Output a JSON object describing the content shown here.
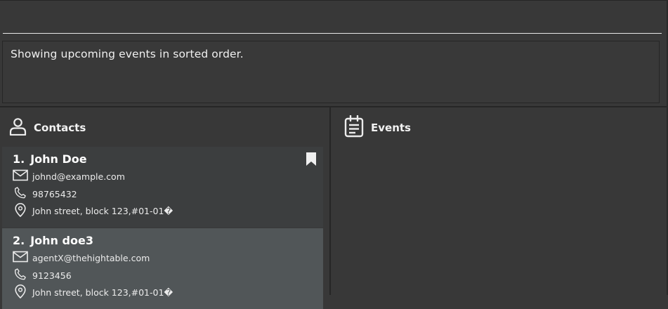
{
  "command": {
    "value": "",
    "placeholder": ""
  },
  "result": {
    "message": "Showing upcoming events in sorted order."
  },
  "contacts_panel": {
    "title": "Contacts",
    "icon": "person-icon"
  },
  "events_panel": {
    "title": "Events",
    "icon": "calendar-icon"
  },
  "contacts": [
    {
      "index": "1.",
      "name": "John Doe",
      "email": "johnd@example.com",
      "phone": "98765432",
      "address": "John street, block 123,#01-01�",
      "bookmarked": true
    },
    {
      "index": "2.",
      "name": "John doe3",
      "email": "agentX@thehightable.com",
      "phone": "9123456",
      "address": "John street, block 123,#01-01�",
      "bookmarked": false
    }
  ],
  "colors": {
    "background": "#383838",
    "card_default": "#3c3e3f",
    "card_selected": "#515658",
    "text": "#ffffff"
  }
}
